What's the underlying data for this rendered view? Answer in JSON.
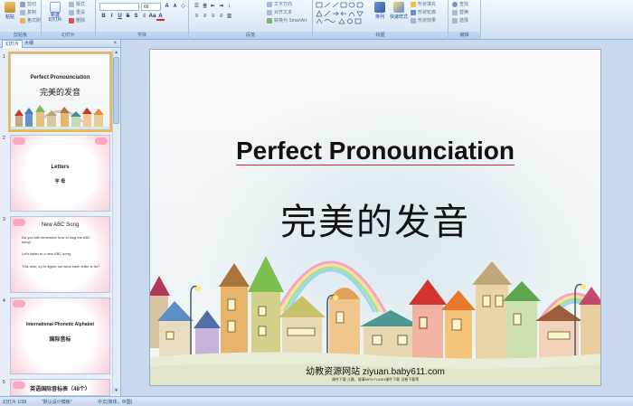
{
  "ribbon": {
    "groups": [
      {
        "label": "剪贴板"
      },
      {
        "label": "幻灯片"
      },
      {
        "label": "字体"
      },
      {
        "label": "段落"
      },
      {
        "label": "绘图"
      },
      {
        "label": "编辑"
      }
    ],
    "paste_label": "粘贴",
    "cut_label": "剪切",
    "copy_label": "复制",
    "format_painter_label": "格式刷",
    "new_slide_label": "新建\n幻灯片",
    "layout_label": "版式",
    "reset_label": "重设",
    "delete_label": "删除",
    "font_size": "66",
    "text_direction_label": "文字方向",
    "align_text_label": "对齐文本",
    "smartart_label": "转换为 SmartArt",
    "arrange_label": "排列",
    "quick_styles_label": "快速样式",
    "shape_fill_label": "形状填充",
    "shape_outline_label": "形状轮廓",
    "shape_effects_label": "形状效果",
    "find_label": "查找",
    "replace_label": "替换",
    "select_label": "选择"
  },
  "left_panel": {
    "tabs": [
      "幻灯片",
      "大纲"
    ],
    "close_glyph": "×",
    "slides": [
      {
        "num": "1",
        "title": "Perfect Pronounciation",
        "subtitle": "完美的发音"
      },
      {
        "num": "2",
        "title": "Letters",
        "subtitle": "字 母"
      },
      {
        "num": "3",
        "title": "New ABC Song",
        "bullets": [
          "Do you still remember how to sing the ABC song?",
          "Let's listen to a new ABC song.",
          "This time, try to figure out what each letter is for?"
        ]
      },
      {
        "num": "4",
        "title": "International Phonetic Alphabet",
        "subtitle": "国际音标"
      },
      {
        "num": "5",
        "title": "英语国际音标表（48个）"
      }
    ]
  },
  "slide": {
    "title": "Perfect Pronounciation",
    "subtitle": "完美的发音",
    "footer_line1": "幼教资源网站  ziyuan.baby611.com",
    "footer_line2": "课件下载    儿歌、故事MP3    FLASH课件下载    试卷下载等"
  },
  "status": {
    "slide_pos": "幻灯片 1/38",
    "theme": "\"默认设计模板\"",
    "language": "中文(简体，中国)"
  },
  "colors": {
    "ribbon_bg": "#dfeaf7",
    "selection": "#f5b545",
    "workspace": "#c8d9ee"
  }
}
